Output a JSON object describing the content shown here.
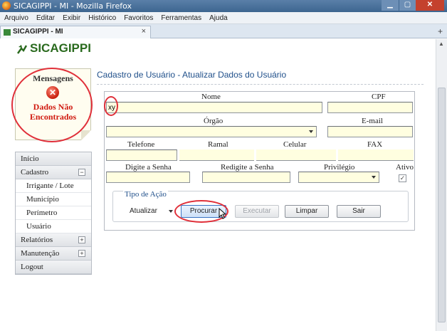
{
  "window": {
    "title": "SICAGIPPI - MI - Mozilla Firefox"
  },
  "menubar": {
    "items": [
      "Arquivo",
      "Editar",
      "Exibir",
      "Histórico",
      "Favoritos",
      "Ferramentas",
      "Ajuda"
    ]
  },
  "tab": {
    "label": "SICAGIPPI - MI",
    "close": "×",
    "new": "+"
  },
  "app": {
    "logo": "SICAGIPPI"
  },
  "messages": {
    "title": "Mensagens",
    "line1": "Dados Não",
    "line2": "Encontrados"
  },
  "nav": {
    "items": [
      {
        "label": "Início",
        "toggle": ""
      },
      {
        "label": "Cadastro",
        "toggle": "−"
      },
      {
        "label": "Irrigante / Lote",
        "toggle": ""
      },
      {
        "label": "Município",
        "toggle": ""
      },
      {
        "label": "Perímetro",
        "toggle": ""
      },
      {
        "label": "Usuário",
        "toggle": ""
      },
      {
        "label": "Relatórios",
        "toggle": "+"
      },
      {
        "label": "Manutenção",
        "toggle": "+"
      },
      {
        "label": "Logout",
        "toggle": ""
      }
    ]
  },
  "page": {
    "title": "Cadastro de Usuário - Atualizar Dados do Usuário"
  },
  "form": {
    "labels": {
      "nome": "Nome",
      "cpf": "CPF",
      "orgao": "Órgão",
      "email": "E-mail",
      "telefone": "Telefone",
      "ramal": "Ramal",
      "celular": "Celular",
      "fax": "FAX",
      "senha": "Digite a Senha",
      "redigite": "Redigite a Senha",
      "privilegio": "Privilégio",
      "ativo": "Ativo"
    },
    "values": {
      "nome": "xy",
      "ativo_check": "✓"
    },
    "acao": {
      "title": "Tipo de Ação",
      "select_value": "Atualizar",
      "buttons": {
        "procurar": "Procurar",
        "executar": "Executar",
        "limpar": "Limpar",
        "sair": "Sair"
      }
    }
  },
  "colors": {
    "accent_circle": "#e0303a",
    "title_blue": "#1f4f8a",
    "error_red": "#d01a10",
    "logo_green": "#2a6a1e"
  }
}
